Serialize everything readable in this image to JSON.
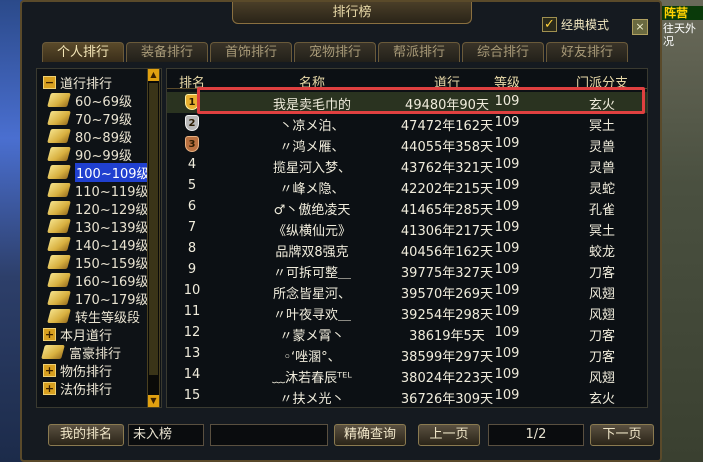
{
  "window": {
    "title": "排行榜",
    "classic_mode_label": "经典模式",
    "classic_mode_checked": true,
    "close": "×"
  },
  "side_right": {
    "badge": "阵营",
    "text": "往天外\n况"
  },
  "tabs": [
    {
      "label": "个人排行",
      "active": true
    },
    {
      "label": "装备排行"
    },
    {
      "label": "首饰排行"
    },
    {
      "label": "宠物排行"
    },
    {
      "label": "帮派排行"
    },
    {
      "label": "综合排行"
    },
    {
      "label": "好友排行"
    }
  ],
  "tree": [
    {
      "label": "道行排行",
      "type": "cat",
      "expanded": true
    },
    {
      "label": "60~69级"
    },
    {
      "label": "70~79级"
    },
    {
      "label": "80~89级"
    },
    {
      "label": "90~99级"
    },
    {
      "label": "100~109级",
      "selected": true
    },
    {
      "label": "110~119级"
    },
    {
      "label": "120~129级"
    },
    {
      "label": "130~139级"
    },
    {
      "label": "140~149级"
    },
    {
      "label": "150~159级"
    },
    {
      "label": "160~169级"
    },
    {
      "label": "170~179级"
    },
    {
      "label": "转生等级段"
    },
    {
      "label": "本月道行",
      "type": "cat"
    },
    {
      "label": "富豪排行",
      "type": "leaf-scroll"
    },
    {
      "label": "物伤排行",
      "type": "cat"
    },
    {
      "label": "法伤排行",
      "type": "cat"
    }
  ],
  "table": {
    "headers": [
      "排名",
      "名称",
      "道行",
      "等级",
      "门派分支"
    ],
    "rows": [
      {
        "rank": "1",
        "medal": "gold",
        "name": "我是卖毛巾的",
        "dao": "49480年90天",
        "level": "109",
        "school": "玄火"
      },
      {
        "rank": "2",
        "medal": "silver",
        "name": "丶凉メ泊、",
        "dao": "47472年162天",
        "level": "109",
        "school": "冥土"
      },
      {
        "rank": "3",
        "medal": "bronze",
        "name": "〃鸿メ雁、",
        "dao": "44055年358天",
        "level": "109",
        "school": "灵兽"
      },
      {
        "rank": "4",
        "name": "揽星河入梦、",
        "dao": "43762年321天",
        "level": "109",
        "school": "灵兽"
      },
      {
        "rank": "5",
        "name": "〃峰メ隐、",
        "dao": "42202年215天",
        "level": "109",
        "school": "灵蛇"
      },
      {
        "rank": "6",
        "name": "♂丶傲绝凌天",
        "dao": "41465年285天",
        "level": "109",
        "school": "孔雀"
      },
      {
        "rank": "7",
        "name": "《纵横仙元》",
        "dao": "41306年217天",
        "level": "109",
        "school": "冥土"
      },
      {
        "rank": "8",
        "name": "品牌双8强克",
        "dao": "40456年162天",
        "level": "109",
        "school": "蛟龙"
      },
      {
        "rank": "9",
        "name": "〃可拆可整＿",
        "dao": "39775年327天",
        "level": "109",
        "school": "刀客"
      },
      {
        "rank": "10",
        "name": "所念皆星河、",
        "dao": "39570年269天",
        "level": "109",
        "school": "风翅"
      },
      {
        "rank": "11",
        "name": "〃叶夜寻欢＿",
        "dao": "39254年298天",
        "level": "109",
        "school": "风翅"
      },
      {
        "rank": "12",
        "name": "〃蒙メ霄丶",
        "dao": "38619年5天",
        "level": "109",
        "school": "刀客"
      },
      {
        "rank": "13",
        "name": "◦ʻ唑溷°、",
        "dao": "38599年297天",
        "level": "109",
        "school": "刀客"
      },
      {
        "rank": "14",
        "name": "﹏沐若春辰ᵀᴱᴸ",
        "dao": "38024年223天",
        "level": "109",
        "school": "风翅"
      },
      {
        "rank": "15",
        "name": "〃扶メ光丶",
        "dao": "36726年309天",
        "level": "109",
        "school": "玄火"
      }
    ]
  },
  "bottom": {
    "my_rank_label": "我的排名",
    "my_rank_value": "未入榜",
    "search_value": "",
    "search_label": "精确查询",
    "prev_label": "上一页",
    "page": "1/2",
    "next_label": "下一页"
  }
}
